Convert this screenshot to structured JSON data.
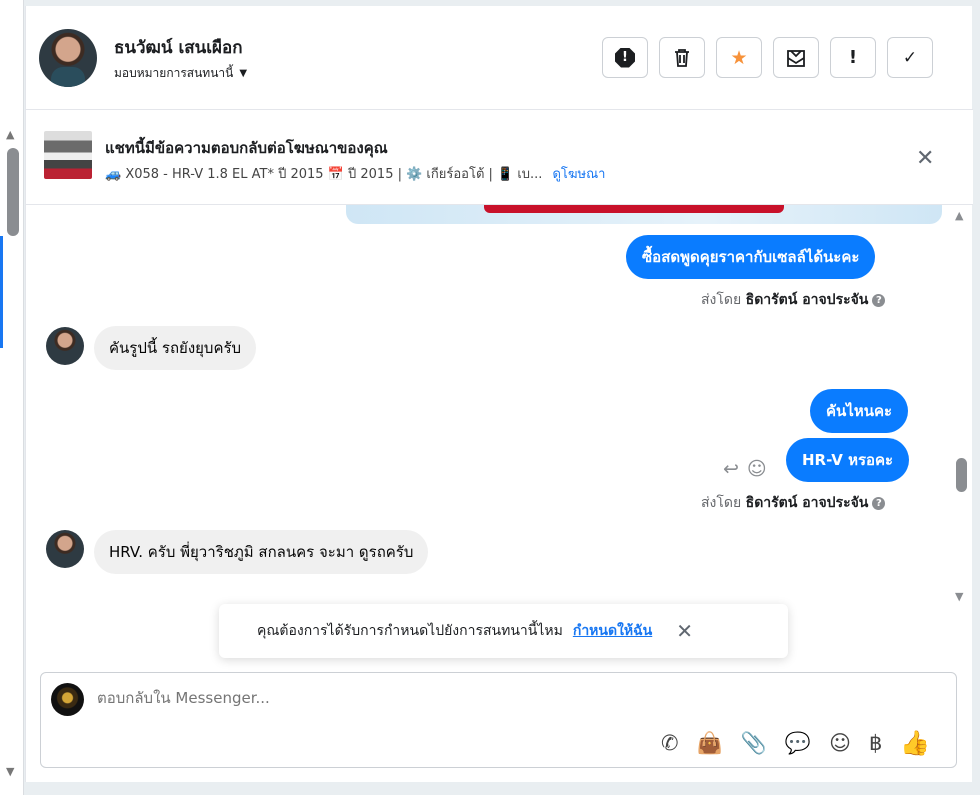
{
  "header": {
    "contact_name": "ธนวัฒน์ เสนเผือก",
    "assign_label": "มอบหมายการสนทนานี้",
    "tools": [
      {
        "icon": "spam-icon"
      },
      {
        "icon": "trash-icon"
      },
      {
        "icon": "star-icon",
        "color": "#f7923a"
      },
      {
        "icon": "mark-unread-icon"
      },
      {
        "icon": "follow-up-icon"
      },
      {
        "icon": "done-check-icon"
      }
    ]
  },
  "ad_banner": {
    "title": "แชทนี้มีข้อความตอบกลับต่อโฆษณาของคุณ",
    "description": "🚙 X058 - HR-V 1.8 EL AT* ปี 2015 📅 ปี 2015 | ⚙️ เกียร์ออโต้ | 📱 เบ...",
    "link": "ดูโฆษณา"
  },
  "messages": [
    {
      "from": "page",
      "text": "ซื้อสดพูดคุยราคากับเซลล์ได้นะคะ"
    },
    {
      "sent_by_prefix": "ส่งโดย",
      "sent_by_name": "ธิดารัตน์ อาจประจัน"
    },
    {
      "from": "customer",
      "text": "คันรูปนี้ รถยังยุบครับ"
    },
    {
      "from": "page",
      "text": "คันไหนคะ"
    },
    {
      "from": "page",
      "text": "HR-V หรอคะ"
    },
    {
      "sent_by_prefix": "ส่งโดย",
      "sent_by_name": "ธิดารัตน์ อาจประจัน"
    },
    {
      "from": "customer",
      "text": "HRV.  ครับ พี่ยุวาริชภูมิ สกลนคร จะมา ดูรถครับ"
    }
  ],
  "assign_toast": {
    "text": "คุณต้องการได้รับการกำหนดไปยังการสนทนานี้ไหม",
    "link": "กำหนดให้ฉัน"
  },
  "composer": {
    "placeholder": "ตอบกลับใน Messenger...",
    "tools": [
      "call-add-icon",
      "shop-bag-icon",
      "attach-icon",
      "saved-reply-icon",
      "emoji-icon",
      "baht-icon",
      "thumbs-up-icon"
    ]
  },
  "colors": {
    "accent": "#0a7cff",
    "link": "#1877f2"
  }
}
